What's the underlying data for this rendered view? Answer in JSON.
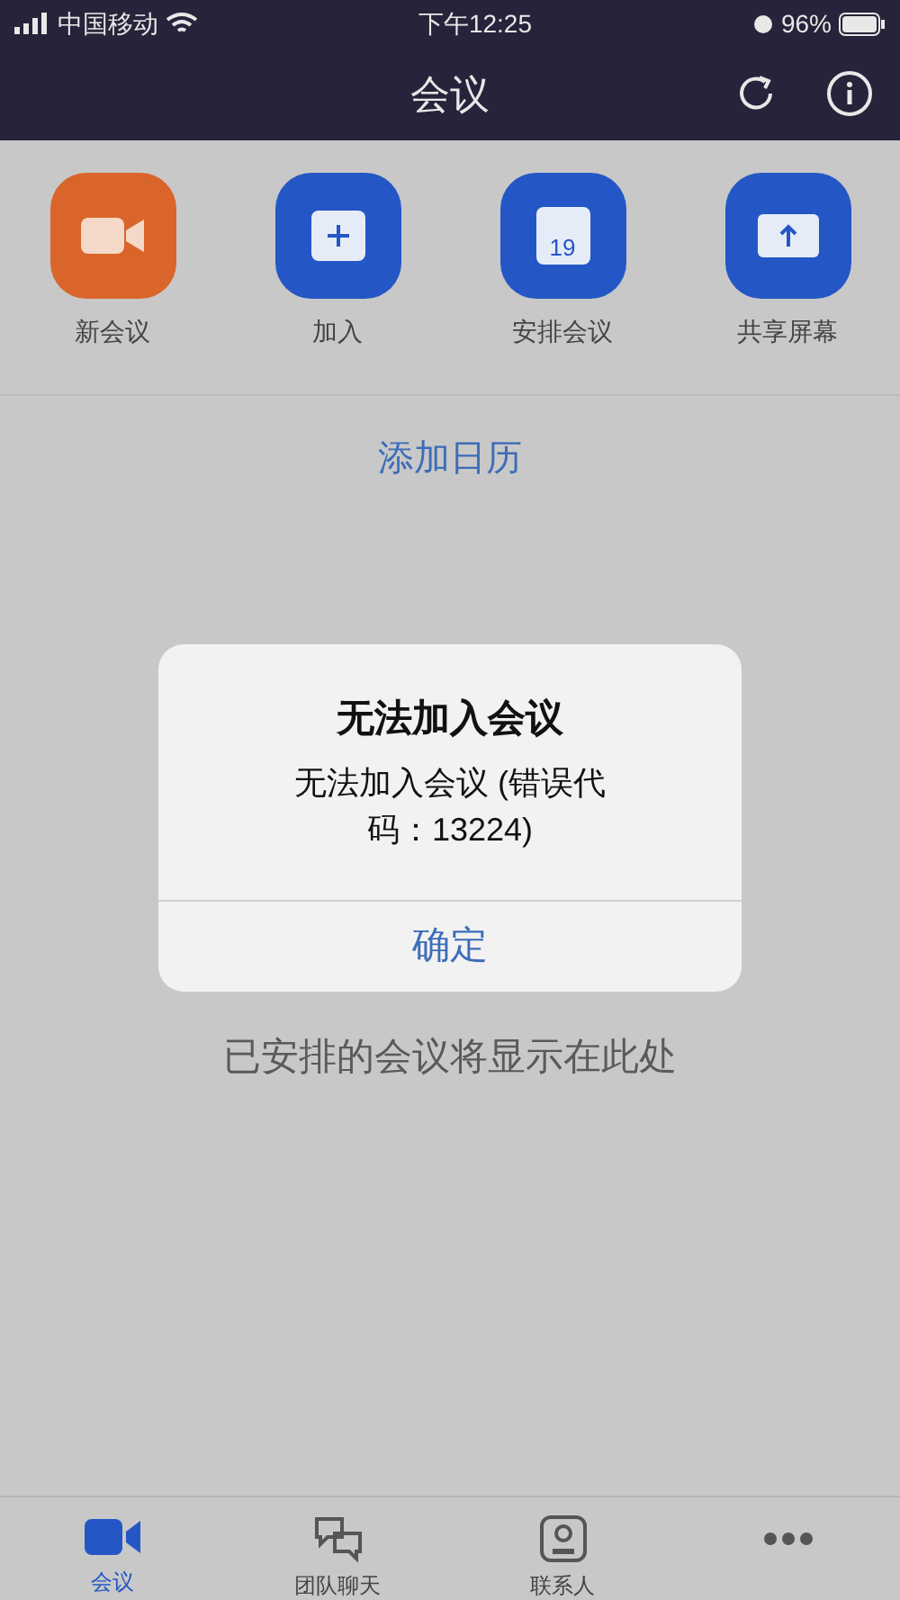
{
  "status_bar": {
    "carrier": "中国移动",
    "time": "下午12:25",
    "battery": "96%"
  },
  "header": {
    "title": "会议"
  },
  "actions": [
    {
      "kind": "video",
      "label": "新会议",
      "color": "#d9652b"
    },
    {
      "kind": "plus",
      "label": "加入",
      "color": "#2457c5"
    },
    {
      "kind": "calendar",
      "label": "安排会议",
      "color": "#2457c5",
      "icon_text": "19"
    },
    {
      "kind": "share",
      "label": "共享屏幕",
      "color": "#2457c5"
    }
  ],
  "add_calendar_link": "添加日历",
  "empty_hint": "已安排的会议将显示在此处",
  "dialog": {
    "title": "无法加入会议",
    "message": "无法加入会议 (错误代码：13224)",
    "button": "确定"
  },
  "tab_bar": [
    {
      "kind": "video",
      "label": "会议",
      "selected": true
    },
    {
      "kind": "chat",
      "label": "团队聊天",
      "selected": false
    },
    {
      "kind": "contact",
      "label": "联系人",
      "selected": false
    },
    {
      "kind": "more",
      "selected": false
    }
  ]
}
